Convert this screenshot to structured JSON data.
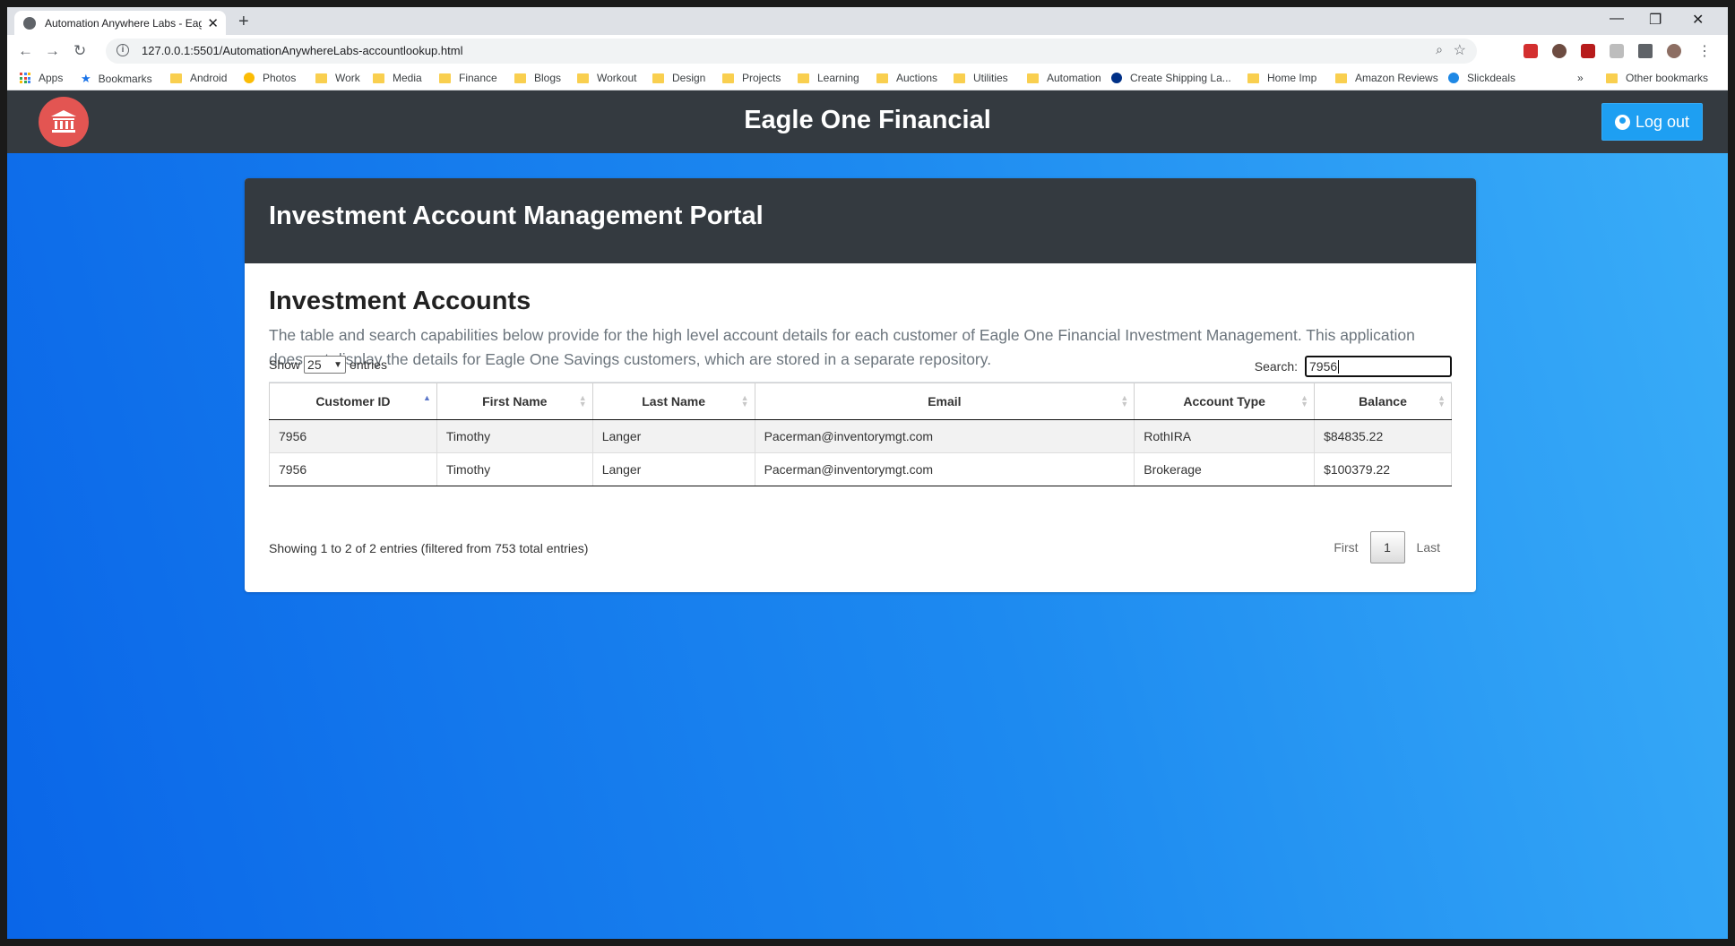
{
  "browser": {
    "tab_title": "Automation Anywhere Labs - Eagle One Financial",
    "url": "127.0.0.1:5501/AutomationAnywhereLabs-accountlookup.html",
    "bookmarks": [
      "Apps",
      "Bookmarks",
      "Android",
      "Photos",
      "Work",
      "Media",
      "Finance",
      "Blogs",
      "Workout",
      "Design",
      "Projects",
      "Learning",
      "Auctions",
      "Utilities",
      "Automation",
      "Create Shipping La...",
      "Home Imp",
      "Amazon Reviews",
      "Slickdeals"
    ],
    "overflow_label": "»",
    "other_bookmarks": "Other bookmarks"
  },
  "navbar": {
    "brand": "Eagle One Financial",
    "logout_label": "Log out",
    "logo_icon": "bank-icon"
  },
  "card": {
    "header_title": "Investment Account Management Portal",
    "section_title": "Investment Accounts",
    "description": "The table and search capabilities below provide for the high level account details for each customer of Eagle One Financial Investment Management. This application does not display the details for Eagle One Savings customers, which are stored in a separate repository."
  },
  "table_controls": {
    "show_label": "Show",
    "entries_value": "25",
    "entries_label": "entries",
    "search_label": "Search:",
    "search_value": "7956"
  },
  "table": {
    "columns": [
      "Customer ID",
      "First Name",
      "Last Name",
      "Email",
      "Account Type",
      "Balance"
    ],
    "rows": [
      [
        "7956",
        "Timothy",
        "Langer",
        "Pacerman@inventorymgt.com",
        "RothIRA",
        "$84835.22"
      ],
      [
        "7956",
        "Timothy",
        "Langer",
        "Pacerman@inventorymgt.com",
        "Brokerage",
        "$100379.22"
      ]
    ]
  },
  "footer": {
    "info": "Showing 1 to 2 of 2 entries (filtered from 753 total entries)",
    "first": "First",
    "page": "1",
    "last": "Last"
  },
  "colors": {
    "navbar": "#343a40",
    "logo_bg": "#e35552",
    "logout_bg": "#1e9ff2",
    "gradient_start": "#0a66e8",
    "gradient_end": "#3aaef8"
  }
}
